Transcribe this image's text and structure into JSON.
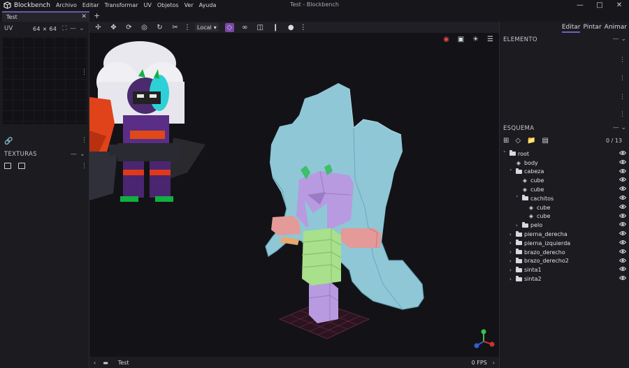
{
  "app": {
    "name": "Blockbench",
    "window_title": "Test - Blockbench",
    "menu": [
      "Archivo",
      "Editar",
      "Transformar",
      "UV",
      "Objetos",
      "Ver",
      "Ayuda"
    ]
  },
  "tabs": [
    {
      "label": "Test"
    }
  ],
  "left_panel": {
    "uv_title": "UV",
    "uv_size": "64 × 64",
    "textures_title": "TEXTURAS"
  },
  "toolbar": {
    "space": "Local"
  },
  "right_panel": {
    "modes": [
      "Editar",
      "Pintar",
      "Animar"
    ],
    "element_title": "ELEMENTO",
    "outliner_title": "ESQUEMA",
    "outliner_count": "0 / 13",
    "outliner": [
      {
        "label": "root",
        "type": "folder",
        "depth": 0,
        "open": true
      },
      {
        "label": "body",
        "type": "cube-group",
        "depth": 1,
        "open": null
      },
      {
        "label": "cabeza",
        "type": "folder",
        "depth": 1,
        "open": true
      },
      {
        "label": "cube",
        "type": "cube",
        "depth": 2,
        "open": null
      },
      {
        "label": "cube",
        "type": "cube",
        "depth": 2,
        "open": null
      },
      {
        "label": "cachitos",
        "type": "folder",
        "depth": 2,
        "open": true
      },
      {
        "label": "cube",
        "type": "cube",
        "depth": 3,
        "open": null
      },
      {
        "label": "cube",
        "type": "cube",
        "depth": 3,
        "open": null
      },
      {
        "label": "pelo",
        "type": "folder",
        "depth": 2,
        "open": false
      },
      {
        "label": "pierna_derecha",
        "type": "folder",
        "depth": 1,
        "open": false
      },
      {
        "label": "pierna_izquierda",
        "type": "folder",
        "depth": 1,
        "open": false
      },
      {
        "label": "brazo_derecho",
        "type": "folder",
        "depth": 1,
        "open": false
      },
      {
        "label": "brazo_derecho2",
        "type": "folder",
        "depth": 1,
        "open": false
      },
      {
        "label": "sinta1",
        "type": "folder",
        "depth": 1,
        "open": false
      },
      {
        "label": "sinta2",
        "type": "folder",
        "depth": 1,
        "open": false
      }
    ]
  },
  "status": {
    "model_name": "Test",
    "fps": "0 FPS"
  },
  "colors": {
    "accent": "#7a5ac0",
    "model_body": "#8fc7d6",
    "model_head": "#b89ae0",
    "model_arm": "#e39a98",
    "model_torso": "#a8e08c"
  }
}
